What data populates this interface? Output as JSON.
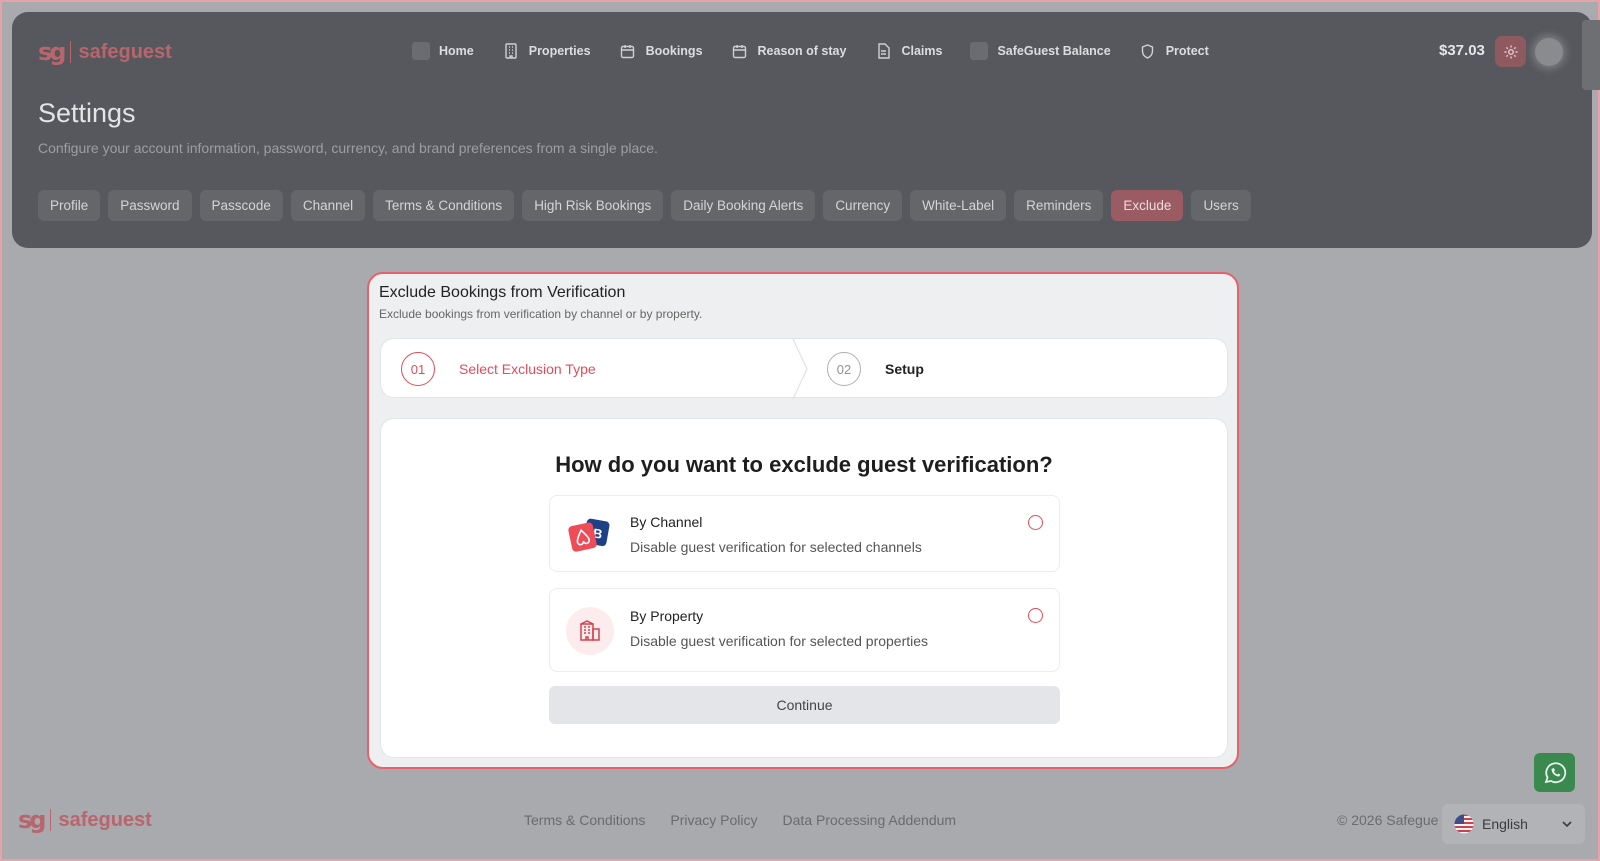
{
  "brand": {
    "mark": "sg",
    "name": "safeguest"
  },
  "nav": {
    "items": [
      {
        "label": "Home",
        "icon": "home-icon"
      },
      {
        "label": "Properties",
        "icon": "building-icon"
      },
      {
        "label": "Bookings",
        "icon": "calendar-icon"
      },
      {
        "label": "Reason of stay",
        "icon": "calendar-icon"
      },
      {
        "label": "Claims",
        "icon": "document-icon"
      },
      {
        "label": "SafeGuest Balance",
        "icon": "wallet-icon"
      },
      {
        "label": "Protect",
        "icon": "shield-icon"
      }
    ],
    "balance": "$37.03"
  },
  "page": {
    "title": "Settings",
    "subtitle": "Configure your account information, password, currency, and brand preferences from a single place."
  },
  "tabs": [
    {
      "label": "Profile"
    },
    {
      "label": "Password"
    },
    {
      "label": "Passcode"
    },
    {
      "label": "Channel"
    },
    {
      "label": "Terms & Conditions"
    },
    {
      "label": "High Risk Bookings"
    },
    {
      "label": "Daily Booking Alerts"
    },
    {
      "label": "Currency"
    },
    {
      "label": "White-Label"
    },
    {
      "label": "Reminders"
    },
    {
      "label": "Exclude",
      "active": true
    },
    {
      "label": "Users"
    }
  ],
  "card": {
    "title": "Exclude Bookings from Verification",
    "subtitle": "Exclude bookings from verification by channel or by property.",
    "steps": [
      {
        "number": "01",
        "label": "Select Exclusion Type"
      },
      {
        "number": "02",
        "label": "Setup"
      }
    ],
    "question": "How do you want to exclude guest verification?",
    "options": [
      {
        "title": "By Channel",
        "description": "Disable guest verification for selected channels"
      },
      {
        "title": "By Property",
        "description": "Disable guest verification for selected properties"
      }
    ],
    "continue_label": "Continue"
  },
  "footer": {
    "links": [
      {
        "label": "Terms & Conditions"
      },
      {
        "label": "Privacy Policy"
      },
      {
        "label": "Data Processing Addendum"
      }
    ],
    "copyright": "© 2026 Safegue",
    "language": "English"
  },
  "colors": {
    "accent": "#e44b5a",
    "header_bg": "#56585d",
    "page_bg": "#a9aaad",
    "whatsapp": "#3a8a4f"
  }
}
